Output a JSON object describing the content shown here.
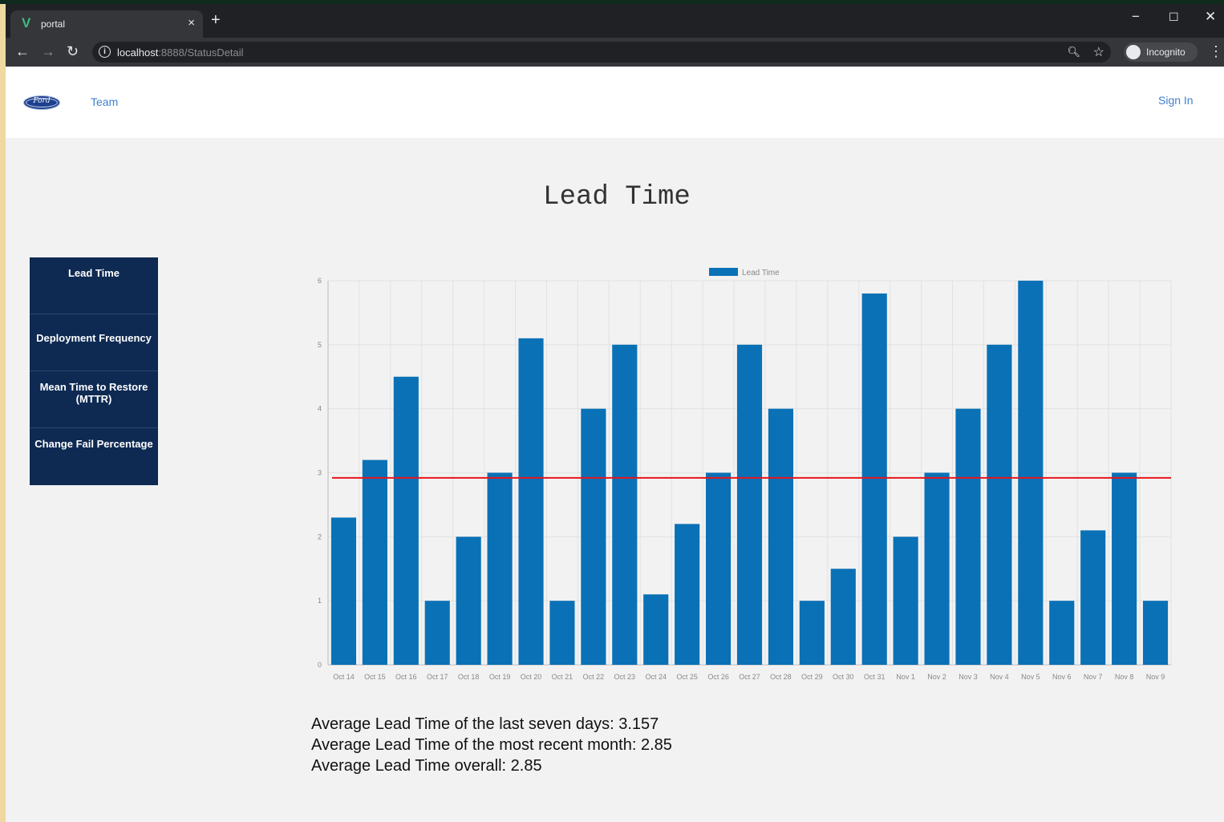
{
  "browser": {
    "tab_title": "portal",
    "tab_close": "×",
    "new_tab": "+",
    "url_host": "localhost",
    "url_path": ":8888/StatusDetail",
    "profile_label": "Incognito",
    "win_min": "−",
    "win_max": "☐",
    "win_close": "✕",
    "back": "←",
    "forward": "→",
    "reload": "↻",
    "menu": "⋮"
  },
  "nav": {
    "logo_text": "Ford",
    "team_link": "Team",
    "sign_in": "Sign In"
  },
  "page": {
    "title": "Lead Time"
  },
  "sidebar": {
    "items": [
      {
        "label": "Lead Time"
      },
      {
        "label": "Deployment Frequency"
      },
      {
        "label": "Mean Time to Restore (MTTR)"
      },
      {
        "label": "Change Fail Percentage"
      }
    ]
  },
  "chart_data": {
    "type": "bar",
    "legend": [
      "Lead Time"
    ],
    "categories": [
      "Oct 14",
      "Oct 15",
      "Oct 16",
      "Oct 17",
      "Oct 18",
      "Oct 19",
      "Oct 20",
      "Oct 21",
      "Oct 22",
      "Oct 23",
      "Oct 24",
      "Oct 25",
      "Oct 26",
      "Oct 27",
      "Oct 28",
      "Oct 29",
      "Oct 30",
      "Oct 31",
      "Nov 1",
      "Nov 2",
      "Nov 3",
      "Nov 4",
      "Nov 5",
      "Nov 6",
      "Nov 7",
      "Nov 8",
      "Nov 9"
    ],
    "series": [
      {
        "name": "Lead Time",
        "values": [
          2.3,
          3.2,
          4.5,
          1,
          2,
          3,
          5.1,
          1,
          4,
          5,
          1.1,
          2.2,
          3,
          5,
          4,
          1,
          1.5,
          5.8,
          2,
          3,
          4,
          5,
          6,
          1,
          2.1,
          3,
          1
        ]
      }
    ],
    "reference_line": 2.92,
    "ylim": [
      0,
      6
    ],
    "yticks": [
      0,
      1,
      2,
      3,
      4,
      5,
      6
    ],
    "grid": true,
    "legend_position": "top",
    "bar_color": "#0a71b6",
    "line_color": "#e8141c"
  },
  "stats": {
    "last_seven": "Average Lead Time of the last seven days: 3.157",
    "recent_month": "Average Lead Time of the most recent month: 2.85",
    "overall": "Average Lead Time overall: 2.85"
  }
}
